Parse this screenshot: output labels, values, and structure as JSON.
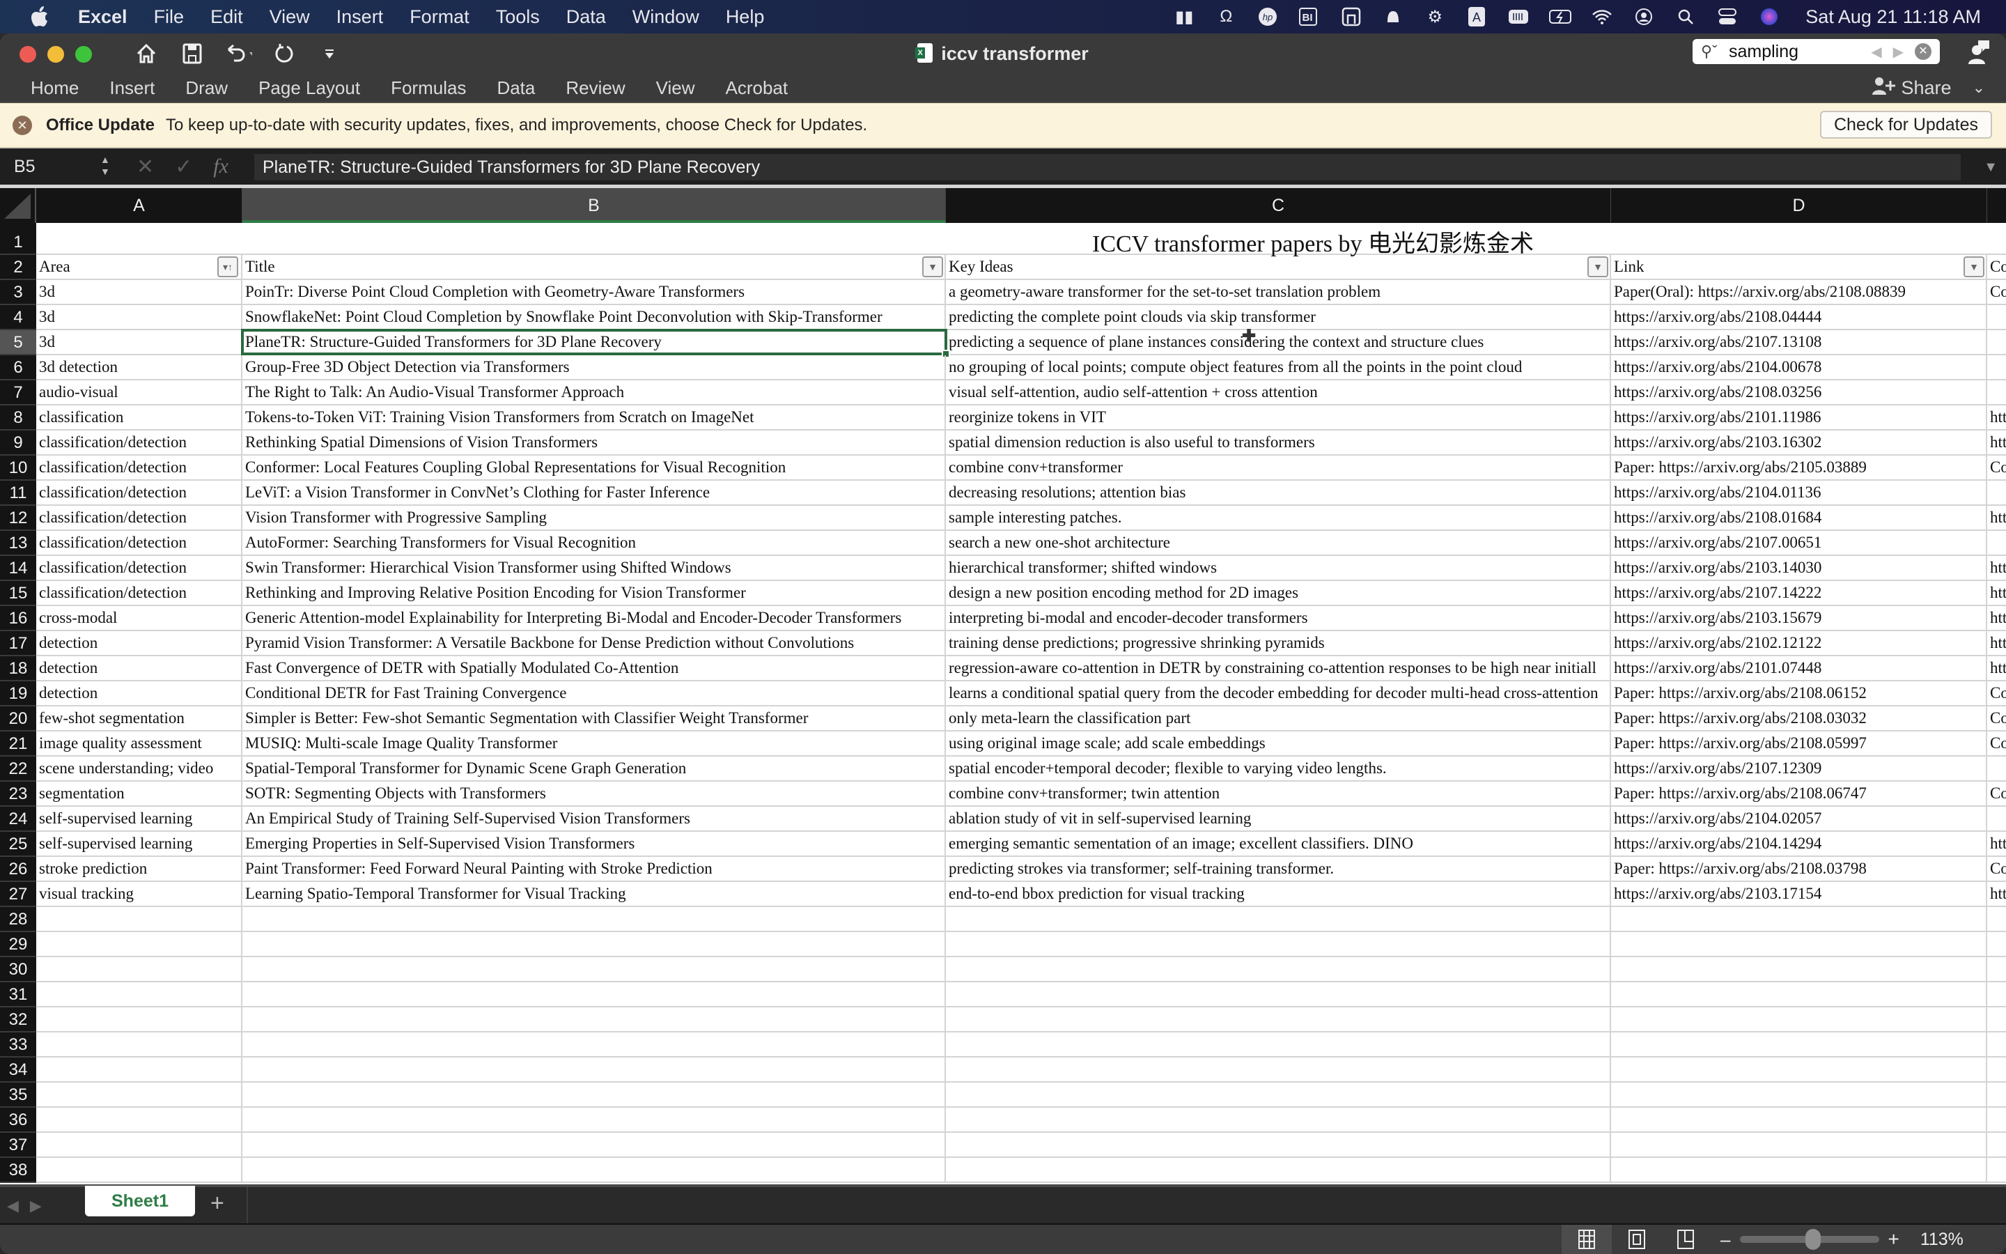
{
  "menubar": {
    "app": "Excel",
    "items": [
      "File",
      "Edit",
      "View",
      "Insert",
      "Format",
      "Tools",
      "Data",
      "Window",
      "Help"
    ],
    "status_icons": [
      "zoom-icon",
      "headphones-icon",
      "hp-icon",
      "bi-icon",
      "screen-icon",
      "notification-icon",
      "microphone-icon",
      "input-a-icon",
      "keyboard-icon",
      "battery-icon",
      "wifi-icon",
      "user-icon",
      "spotlight-icon",
      "control-center-icon",
      "siri-icon"
    ],
    "clock": "Sat Aug 21  11:18 AM"
  },
  "window": {
    "title": "iccv transformer",
    "search": {
      "value": "sampling"
    }
  },
  "ribbon": {
    "tabs": [
      "Home",
      "Insert",
      "Draw",
      "Page Layout",
      "Formulas",
      "Data",
      "Review",
      "View",
      "Acrobat"
    ],
    "share_label": "Share"
  },
  "update_bar": {
    "title": "Office Update",
    "message": "To keep up-to-date with security updates, fixes, and improvements, choose Check for Updates.",
    "button": "Check for Updates"
  },
  "formula_bar": {
    "name_box": "B5",
    "value": "PlaneTR: Structure-Guided Transformers for 3D Plane Recovery"
  },
  "grid": {
    "columns": [
      "A",
      "B",
      "C",
      "D"
    ],
    "selected_column": "B",
    "selected_row": 5,
    "sheet_title": "ICCV transformer papers by 电光幻影炼金术",
    "headers": {
      "A": "Area",
      "B": "Title",
      "C": "Key Ideas",
      "D": "Link",
      "E": "Co"
    },
    "rows": [
      {
        "n": 3,
        "A": "3d",
        "B": "PoinTr: Diverse Point Cloud Completion with Geometry-Aware Transformers",
        "C": "a geometry-aware transformer for the set-to-set translation problem",
        "D": "Paper(Oral): https://arxiv.org/abs/2108.08839",
        "E": "Co"
      },
      {
        "n": 4,
        "A": "3d",
        "B": "SnowflakeNet: Point Cloud Completion by Snowflake Point Deconvolution with Skip-Transformer",
        "C": "predicting the complete point clouds via skip transformer",
        "D": "https://arxiv.org/abs/2108.04444",
        "E": ""
      },
      {
        "n": 5,
        "A": "3d",
        "B": "PlaneTR: Structure-Guided Transformers for 3D Plane Recovery",
        "C": "predicting a sequence of plane instances considering the context and structure clues",
        "D": "https://arxiv.org/abs/2107.13108",
        "E": ""
      },
      {
        "n": 6,
        "A": "3d detection",
        "B": "Group-Free 3D Object Detection via Transformers",
        "C": "no grouping of local points; compute object features from all the points in the point cloud",
        "D": "https://arxiv.org/abs/2104.00678",
        "E": ""
      },
      {
        "n": 7,
        "A": "audio-visual",
        "B": "The Right to Talk: An Audio-Visual Transformer Approach",
        "C": "visual self-attention, audio self-attention + cross attention",
        "D": "https://arxiv.org/abs/2108.03256",
        "E": ""
      },
      {
        "n": 8,
        "A": "classification",
        "B": "Tokens-to-Token ViT: Training Vision Transformers from Scratch on ImageNet",
        "C": "reorginize tokens in VIT",
        "D": "https://arxiv.org/abs/2101.11986",
        "E": "htt"
      },
      {
        "n": 9,
        "A": "classification/detection",
        "B": "Rethinking Spatial Dimensions of Vision Transformers",
        "C": "spatial dimension reduction is also useful to transformers",
        "D": "https://arxiv.org/abs/2103.16302",
        "E": "htt"
      },
      {
        "n": 10,
        "A": "classification/detection",
        "B": "Conformer: Local Features Coupling Global Representations for Visual Recognition",
        "C": "combine conv+transformer",
        "D": "Paper: https://arxiv.org/abs/2105.03889",
        "E": "Co"
      },
      {
        "n": 11,
        "A": "classification/detection",
        "B": "LeViT: a Vision Transformer in ConvNet’s Clothing for Faster Inference",
        "C": "decreasing resolutions; attention bias",
        "D": "https://arxiv.org/abs/2104.01136",
        "E": ""
      },
      {
        "n": 12,
        "A": "classification/detection",
        "B": "Vision Transformer with Progressive Sampling",
        "C": "sample interesting patches.",
        "D": "https://arxiv.org/abs/2108.01684",
        "E": "htt"
      },
      {
        "n": 13,
        "A": "classification/detection",
        "B": "AutoFormer: Searching Transformers for Visual Recognition",
        "C": "search a new one-shot architecture",
        "D": "https://arxiv.org/abs/2107.00651",
        "E": ""
      },
      {
        "n": 14,
        "A": "classification/detection",
        "B": "Swin Transformer: Hierarchical Vision Transformer using Shifted Windows",
        "C": "hierarchical transformer; shifted windows",
        "D": "https://arxiv.org/abs/2103.14030",
        "E": "htt"
      },
      {
        "n": 15,
        "A": "classification/detection",
        "B": "Rethinking and Improving Relative Position Encoding for Vision Transformer",
        "C": "design a new position encoding method for 2D images",
        "D": "https://arxiv.org/abs/2107.14222",
        "E": "htt"
      },
      {
        "n": 16,
        "A": "cross-modal",
        "B": "Generic Attention-model Explainability for Interpreting Bi-Modal and Encoder-Decoder Transformers",
        "C": "interpreting bi-modal and encoder-decoder transformers",
        "D": "https://arxiv.org/abs/2103.15679",
        "E": "htt"
      },
      {
        "n": 17,
        "A": "detection",
        "B": "Pyramid Vision Transformer: A Versatile Backbone for Dense Prediction without Convolutions",
        "C": "training dense predictions; progressive shrinking pyramids",
        "D": "https://arxiv.org/abs/2102.12122",
        "E": "htt"
      },
      {
        "n": 18,
        "A": "detection",
        "B": "Fast Convergence of DETR with Spatially Modulated Co-Attention",
        "C": "regression-aware co-attention in DETR by constraining co-attention responses to be high near initiall",
        "D": "https://arxiv.org/abs/2101.07448",
        "E": "htt"
      },
      {
        "n": 19,
        "A": "detection",
        "B": "Conditional DETR for Fast Training Convergence",
        "C": "learns a conditional spatial query from the decoder embedding for decoder multi-head cross-attention",
        "D": "Paper: https://arxiv.org/abs/2108.06152",
        "E": "Co"
      },
      {
        "n": 20,
        "A": "few-shot segmentation",
        "B": "Simpler is Better: Few-shot Semantic Segmentation with Classifier Weight Transformer",
        "C": "only meta-learn the classification part",
        "D": "Paper: https://arxiv.org/abs/2108.03032",
        "E": "Co"
      },
      {
        "n": 21,
        "A": "image quality assessment",
        "B": "MUSIQ: Multi-scale Image Quality Transformer",
        "C": "using original image scale; add scale embeddings",
        "D": "Paper: https://arxiv.org/abs/2108.05997",
        "E": "Co"
      },
      {
        "n": 22,
        "A": "scene understanding; video",
        "B": "Spatial-Temporal Transformer for Dynamic Scene Graph Generation",
        "C": "spatial encoder+temporal decoder; flexible to varying video lengths.",
        "D": "https://arxiv.org/abs/2107.12309",
        "E": ""
      },
      {
        "n": 23,
        "A": "segmentation",
        "B": "SOTR: Segmenting Objects with Transformers",
        "C": "combine conv+transformer; twin attention",
        "D": "Paper: https://arxiv.org/abs/2108.06747",
        "E": "Co"
      },
      {
        "n": 24,
        "A": "self-supervised learning",
        "B": "An Empirical Study of Training Self-Supervised Vision Transformers",
        "C": "ablation study of vit in self-supervised learning",
        "D": "https://arxiv.org/abs/2104.02057",
        "E": ""
      },
      {
        "n": 25,
        "A": "self-supervised learning",
        "B": "Emerging Properties in Self-Supervised Vision Transformers",
        "C": "emerging semantic sementation of an image; excellent classifiers. DINO",
        "D": "https://arxiv.org/abs/2104.14294",
        "E": "htt"
      },
      {
        "n": 26,
        "A": "stroke prediction",
        "B": "Paint Transformer: Feed Forward Neural Painting with Stroke Prediction",
        "C": "predicting strokes via transformer; self-training transformer.",
        "D": "Paper: https://arxiv.org/abs/2108.03798",
        "E": "Co"
      },
      {
        "n": 27,
        "A": "visual tracking",
        "B": "Learning Spatio-Temporal Transformer for Visual Tracking",
        "C": "end-to-end bbox prediction for visual tracking",
        "D": "https://arxiv.org/abs/2103.17154",
        "E": "htt"
      }
    ],
    "empty_rows": [
      28,
      29,
      30,
      31,
      32,
      33,
      34,
      35,
      36,
      37,
      38
    ]
  },
  "sheets": {
    "tabs": [
      "Sheet1"
    ],
    "active": "Sheet1"
  },
  "status_bar": {
    "zoom": "113%",
    "zoom_percent": 113,
    "view_modes": [
      "normal-view",
      "page-layout-view",
      "page-break-view"
    ],
    "active_view": "normal-view"
  },
  "colors": {
    "accent": "#2e7d46",
    "selection_border": "#2a6a3f",
    "update_bar": "#fcf3dc"
  }
}
